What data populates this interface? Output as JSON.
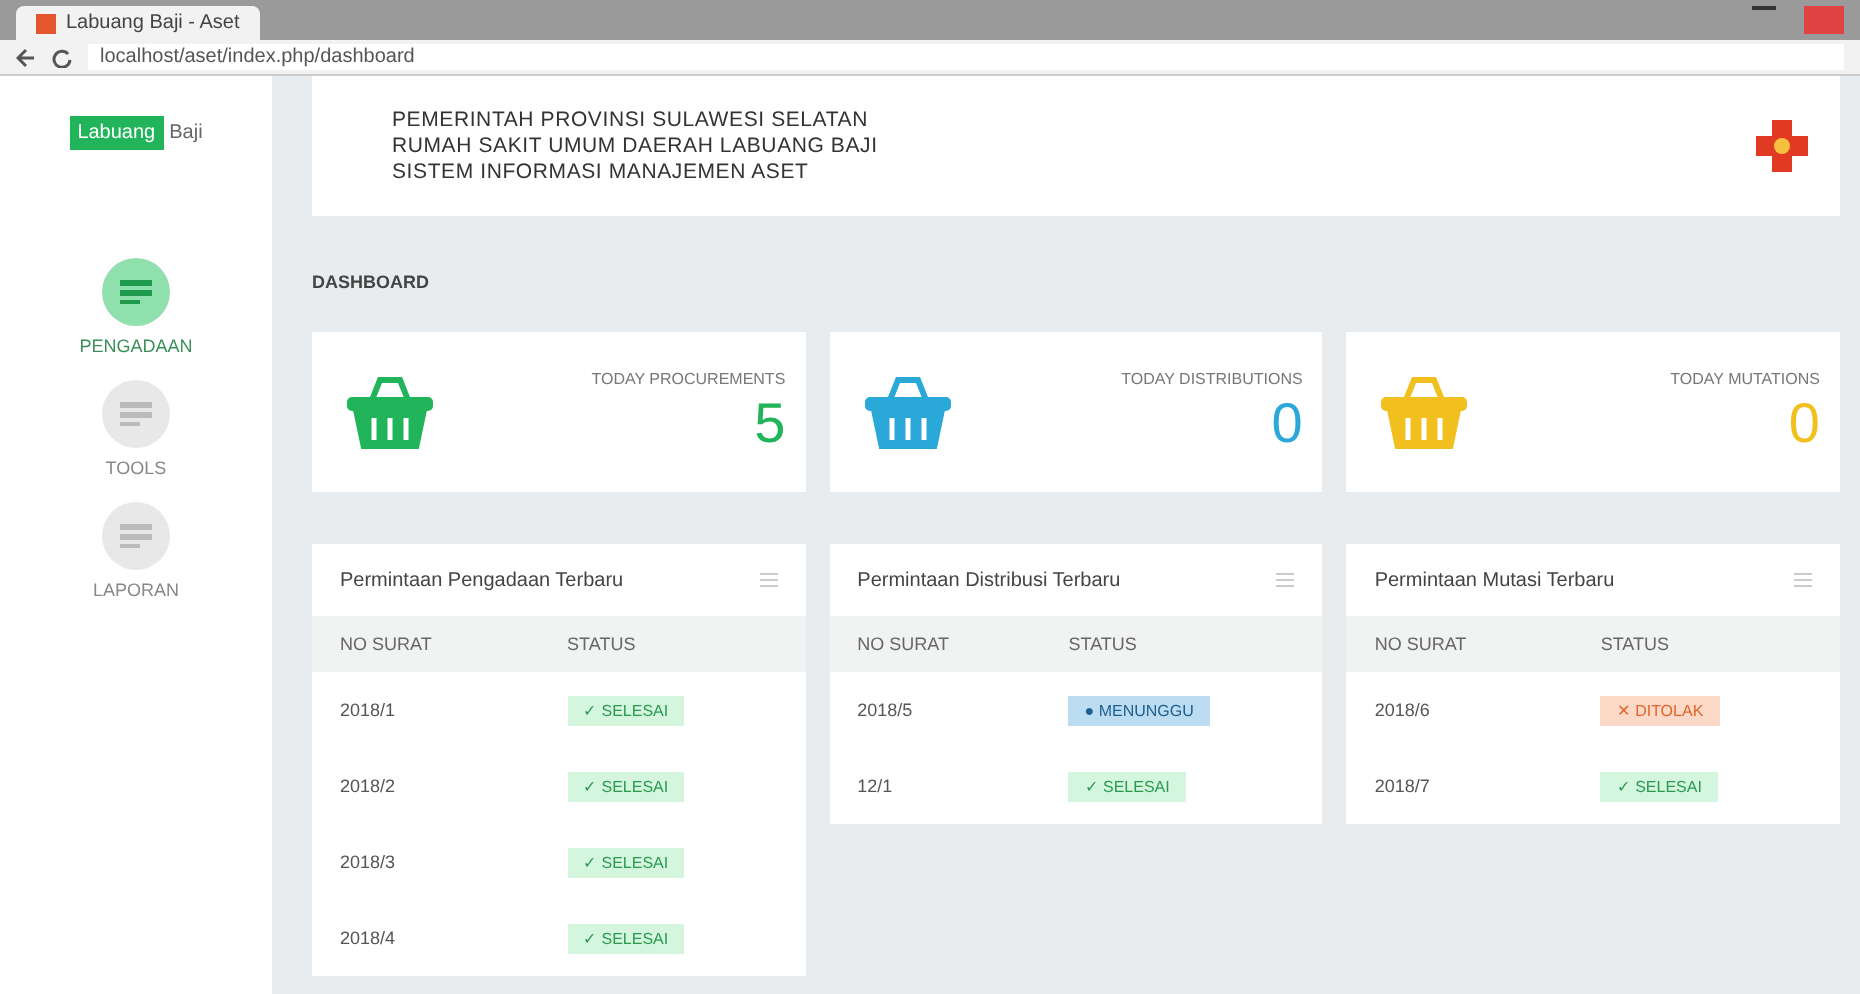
{
  "browser": {
    "tab_title": "Labuang Baji - Aset",
    "url": "localhost/aset/index.php/dashboard"
  },
  "sidebar": {
    "logo_badge": "Labuang",
    "logo_text": "Baji",
    "items": [
      {
        "label": "PENGADAAN",
        "selected": true
      },
      {
        "label": "TOOLS",
        "selected": false
      },
      {
        "label": "LAPORAN",
        "selected": false
      }
    ]
  },
  "header": {
    "lines": [
      "PEMERINTAH PROVINSI SULAWESI SELATAN",
      "RUMAH SAKIT UMUM DAERAH LABUANG BAJI",
      "SISTEM INFORMASI MANAJEMEN ASET"
    ]
  },
  "page_title": "DASHBOARD",
  "stats": [
    {
      "label": "TODAY PROCUREMENTS",
      "value": "5",
      "color": "#22b45a"
    },
    {
      "label": "TODAY DISTRIBUTIONS",
      "value": "0",
      "color": "#2aa8d8"
    },
    {
      "label": "TODAY MUTATIONS",
      "value": "0",
      "color": "#f2c01e"
    }
  ],
  "panels": [
    {
      "title": "Permintaan Pengadaan Terbaru",
      "columns": [
        "NO SURAT",
        "STATUS"
      ],
      "rows": [
        {
          "no": "2018/1",
          "status": "✓ SELESAI",
          "kind": "success"
        },
        {
          "no": "2018/2",
          "status": "✓ SELESAI",
          "kind": "success"
        },
        {
          "no": "2018/3",
          "status": "✓ SELESAI",
          "kind": "success"
        },
        {
          "no": "2018/4",
          "status": "✓ SELESAI",
          "kind": "success"
        }
      ]
    },
    {
      "title": "Permintaan Distribusi Terbaru",
      "columns": [
        "NO SURAT",
        "STATUS"
      ],
      "rows": [
        {
          "no": "2018/5",
          "status": "● MENUNGGU",
          "kind": "info"
        },
        {
          "no": "12/1",
          "status": "✓ SELESAI",
          "kind": "success"
        }
      ]
    },
    {
      "title": "Permintaan Mutasi Terbaru",
      "columns": [
        "NO SURAT",
        "STATUS"
      ],
      "rows": [
        {
          "no": "2018/6",
          "status": "✕ DITOLAK",
          "kind": "danger"
        },
        {
          "no": "2018/7",
          "status": "✓ SELESAI",
          "kind": "success"
        }
      ]
    }
  ]
}
